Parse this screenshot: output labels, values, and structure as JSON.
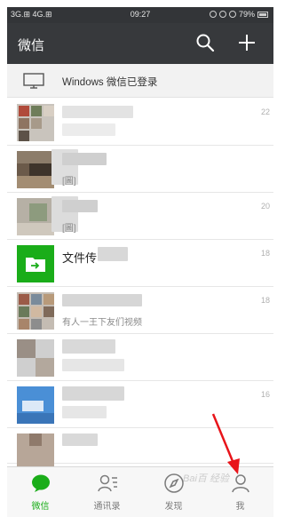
{
  "statusbar": {
    "signal": "3G.⊞ 4G.⊞",
    "time": "09:27",
    "battery": "79%"
  },
  "header": {
    "title": "微信"
  },
  "pc_bar": {
    "text": "Windows 微信已登录"
  },
  "chats": [
    {
      "name": "",
      "preview": "",
      "time": "22"
    },
    {
      "name": "",
      "preview": "[圖]",
      "time": ""
    },
    {
      "name": "",
      "preview": "[圖]",
      "time": "20"
    },
    {
      "name": "文件传输助手",
      "name_visible": "文件传",
      "preview": "",
      "time": "18"
    },
    {
      "name": "",
      "preview": "有人一王下友们视频",
      "time": "18"
    },
    {
      "name": "",
      "preview": "",
      "time": ""
    },
    {
      "name": "",
      "preview": "",
      "time": "16"
    },
    {
      "name": "",
      "preview": "",
      "time": ""
    }
  ],
  "tabs": [
    {
      "label": "微信",
      "icon": "chat-icon",
      "active": true
    },
    {
      "label": "通讯录",
      "icon": "contacts-icon",
      "active": false
    },
    {
      "label": "发现",
      "icon": "compass-icon",
      "active": false
    },
    {
      "label": "我",
      "icon": "person-icon",
      "active": false
    }
  ],
  "colors": {
    "header_bg": "#37393c",
    "accent": "#1aad19",
    "file_transfer": "#1aad19",
    "annotation_arrow": "#e8141a"
  }
}
